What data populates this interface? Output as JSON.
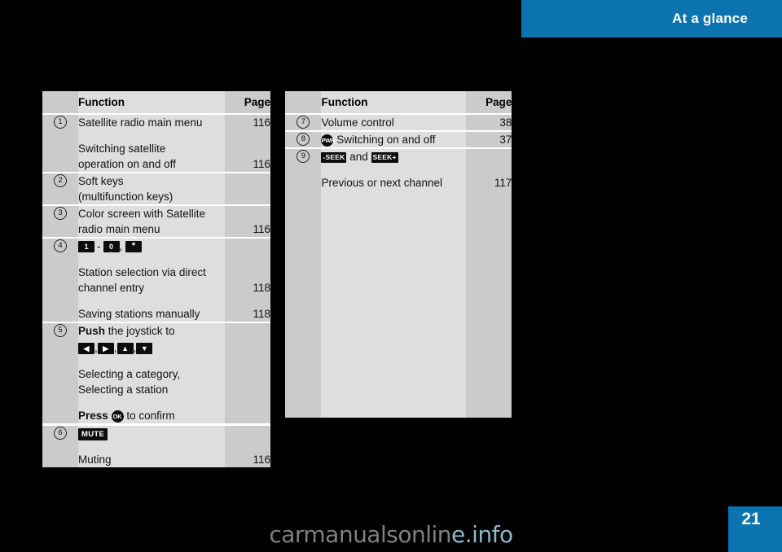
{
  "header": {
    "title": "At a glance",
    "accent_color": "#0b74b0"
  },
  "footer": {
    "page_number": "21",
    "watermark_dark": "carmanualsonlin",
    "watermark_light": "e.info"
  },
  "tables": {
    "left": {
      "columns": {
        "function": "Function",
        "page": "Page"
      },
      "rows": [
        {
          "marker": "1",
          "blocks": [
            {
              "text": "Satellite radio main menu",
              "page": "116"
            },
            {
              "lines": [
                "Switching satellite",
                "operation on and off"
              ],
              "page": "116"
            }
          ]
        },
        {
          "marker": "2",
          "blocks": [
            {
              "lines": [
                "Soft keys",
                "(multifunction keys)"
              ],
              "page": ""
            }
          ]
        },
        {
          "marker": "3",
          "blocks": [
            {
              "lines": [
                "Color screen with Satellite",
                "radio main menu"
              ],
              "page": "116"
            }
          ]
        },
        {
          "marker": "4",
          "blocks": [
            {
              "keys": [
                "1",
                "-",
                "0",
                ",",
                "*"
              ],
              "page": ""
            },
            {
              "lines": [
                "Station selection via direct",
                "channel entry"
              ],
              "page": "118"
            },
            {
              "text": "Saving stations manually",
              "page": "118"
            }
          ]
        },
        {
          "marker": "5",
          "blocks": [
            {
              "bold_lead": "Push",
              "text": " the joystick to",
              "arrows": [
                "◀",
                "▶",
                "▲",
                "▼"
              ],
              "page": ""
            },
            {
              "lines": [
                "Selecting a category,",
                "Selecting a station"
              ],
              "page": ""
            },
            {
              "bold_lead": "Press",
              "ok_key": "OK",
              "text": " to confirm",
              "page": ""
            }
          ]
        },
        {
          "marker": "6",
          "blocks": [
            {
              "key_word": "MUTE",
              "page": ""
            },
            {
              "text": "Muting",
              "page": "116"
            }
          ]
        }
      ]
    },
    "right": {
      "columns": {
        "function": "Function",
        "page": "Page"
      },
      "rows": [
        {
          "marker": "7",
          "blocks": [
            {
              "text": "Volume control",
              "page": "38"
            }
          ]
        },
        {
          "marker": "8",
          "blocks": [
            {
              "round_key": "PWR",
              "text": "Switching on and off",
              "page": "37"
            }
          ]
        },
        {
          "marker": "9",
          "blocks": [
            {
              "seek_minus": "-SEEK",
              "conjunction": "and",
              "seek_plus": "SEEK+",
              "page": ""
            },
            {
              "text": "Previous or next channel",
              "page": "117"
            }
          ]
        }
      ]
    }
  }
}
